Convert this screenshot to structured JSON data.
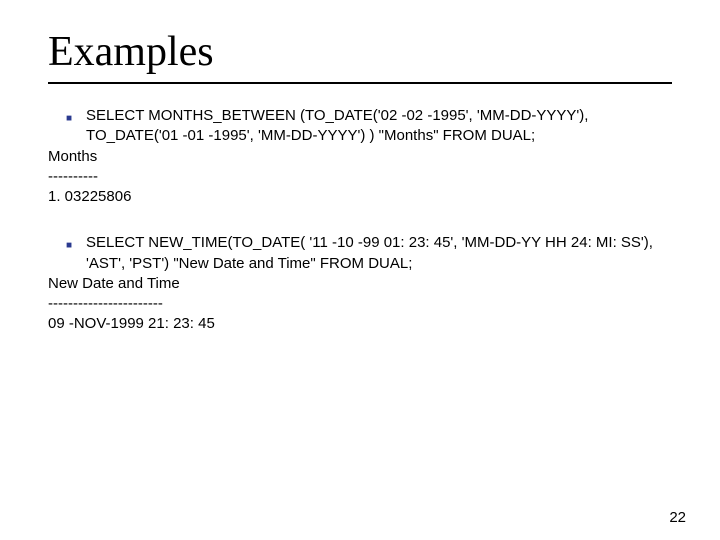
{
  "title": "Examples",
  "block1": {
    "bullet": "SELECT MONTHS_BETWEEN (TO_DATE('02 -02 -1995', 'MM-DD-YYYY'), TO_DATE('01 -01 -1995', 'MM-DD-YYYY') ) \"Months\" FROM DUAL;",
    "r1": "Months",
    "r2": "----------",
    "r3": "1. 03225806"
  },
  "block2": {
    "bullet": "SELECT NEW_TIME(TO_DATE( '11 -10 -99 01: 23: 45', 'MM-DD-YY HH 24: MI: SS'), 'AST', 'PST') \"New Date and Time\" FROM DUAL;",
    "r1": "New Date and Time",
    "r2": "-----------------------",
    "r3": "09 -NOV-1999 21: 23: 45"
  },
  "page_number": "22"
}
